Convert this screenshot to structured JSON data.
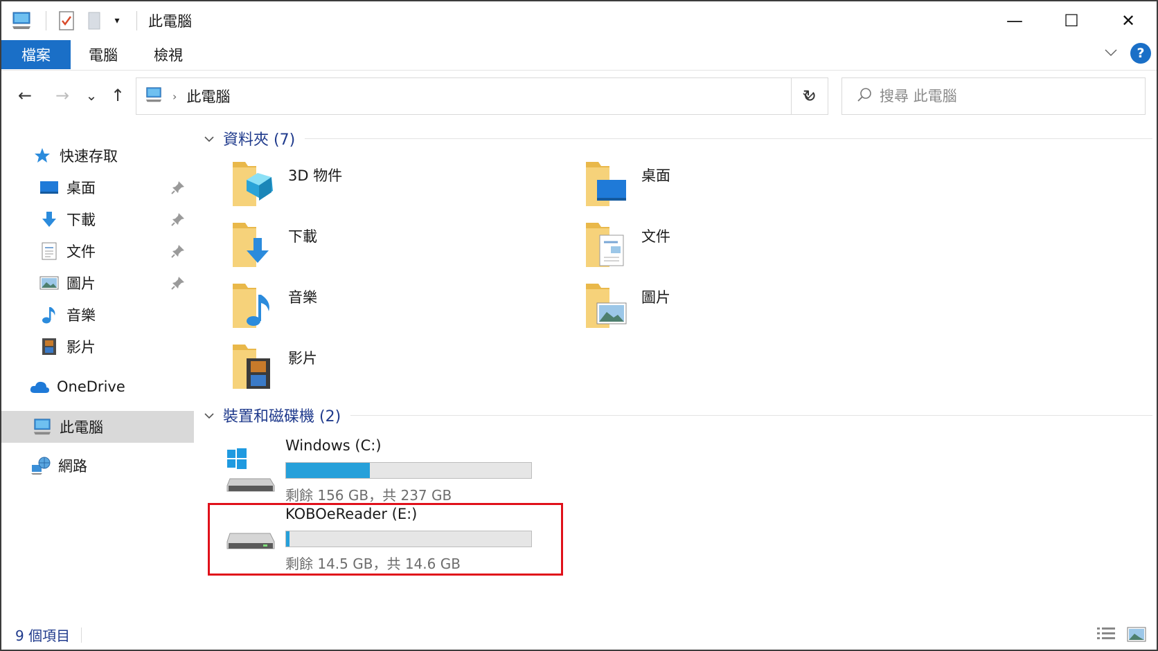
{
  "window": {
    "title": "此電腦",
    "controls": {
      "minimize": "—",
      "maximize": "☐",
      "close": "✕"
    }
  },
  "ribbon": {
    "tabs": [
      {
        "label": "檔案"
      },
      {
        "label": "電腦"
      },
      {
        "label": "檢視"
      }
    ],
    "help": "?"
  },
  "navigation": {
    "back": "←",
    "forward": "→",
    "recent": "⌄",
    "up": "↑",
    "breadcrumb": "此電腦",
    "refresh": "↻",
    "search_placeholder": "搜尋 此電腦"
  },
  "sidebar": {
    "quick_access": "快速存取",
    "items": [
      {
        "label": "桌面",
        "pinned": true
      },
      {
        "label": "下載",
        "pinned": true
      },
      {
        "label": "文件",
        "pinned": true
      },
      {
        "label": "圖片",
        "pinned": true
      },
      {
        "label": "音樂",
        "pinned": false
      },
      {
        "label": "影片",
        "pinned": false
      }
    ],
    "onedrive": "OneDrive",
    "this_pc": "此電腦",
    "network": "網路"
  },
  "content": {
    "folders_header": "資料夾 (7)",
    "folders": [
      {
        "name": "3D 物件"
      },
      {
        "name": "桌面"
      },
      {
        "name": "下載"
      },
      {
        "name": "文件"
      },
      {
        "name": "音樂"
      },
      {
        "name": "圖片"
      },
      {
        "name": "影片"
      }
    ],
    "drives_header": "裝置和磁碟機 (2)",
    "drives": [
      {
        "name": "Windows (C:)",
        "info": "剩餘 156 GB，共 237 GB",
        "used_fraction": 0.342
      },
      {
        "name": "KOBOeReader (E:)",
        "info": "剩餘 14.5 GB，共 14.6 GB",
        "used_fraction": 0.007
      }
    ]
  },
  "status": {
    "item_count": "9 個項目"
  },
  "colors": {
    "accent": "#1a6fc7",
    "usage_bar": "#26a0da",
    "highlight": "#e0101a"
  }
}
